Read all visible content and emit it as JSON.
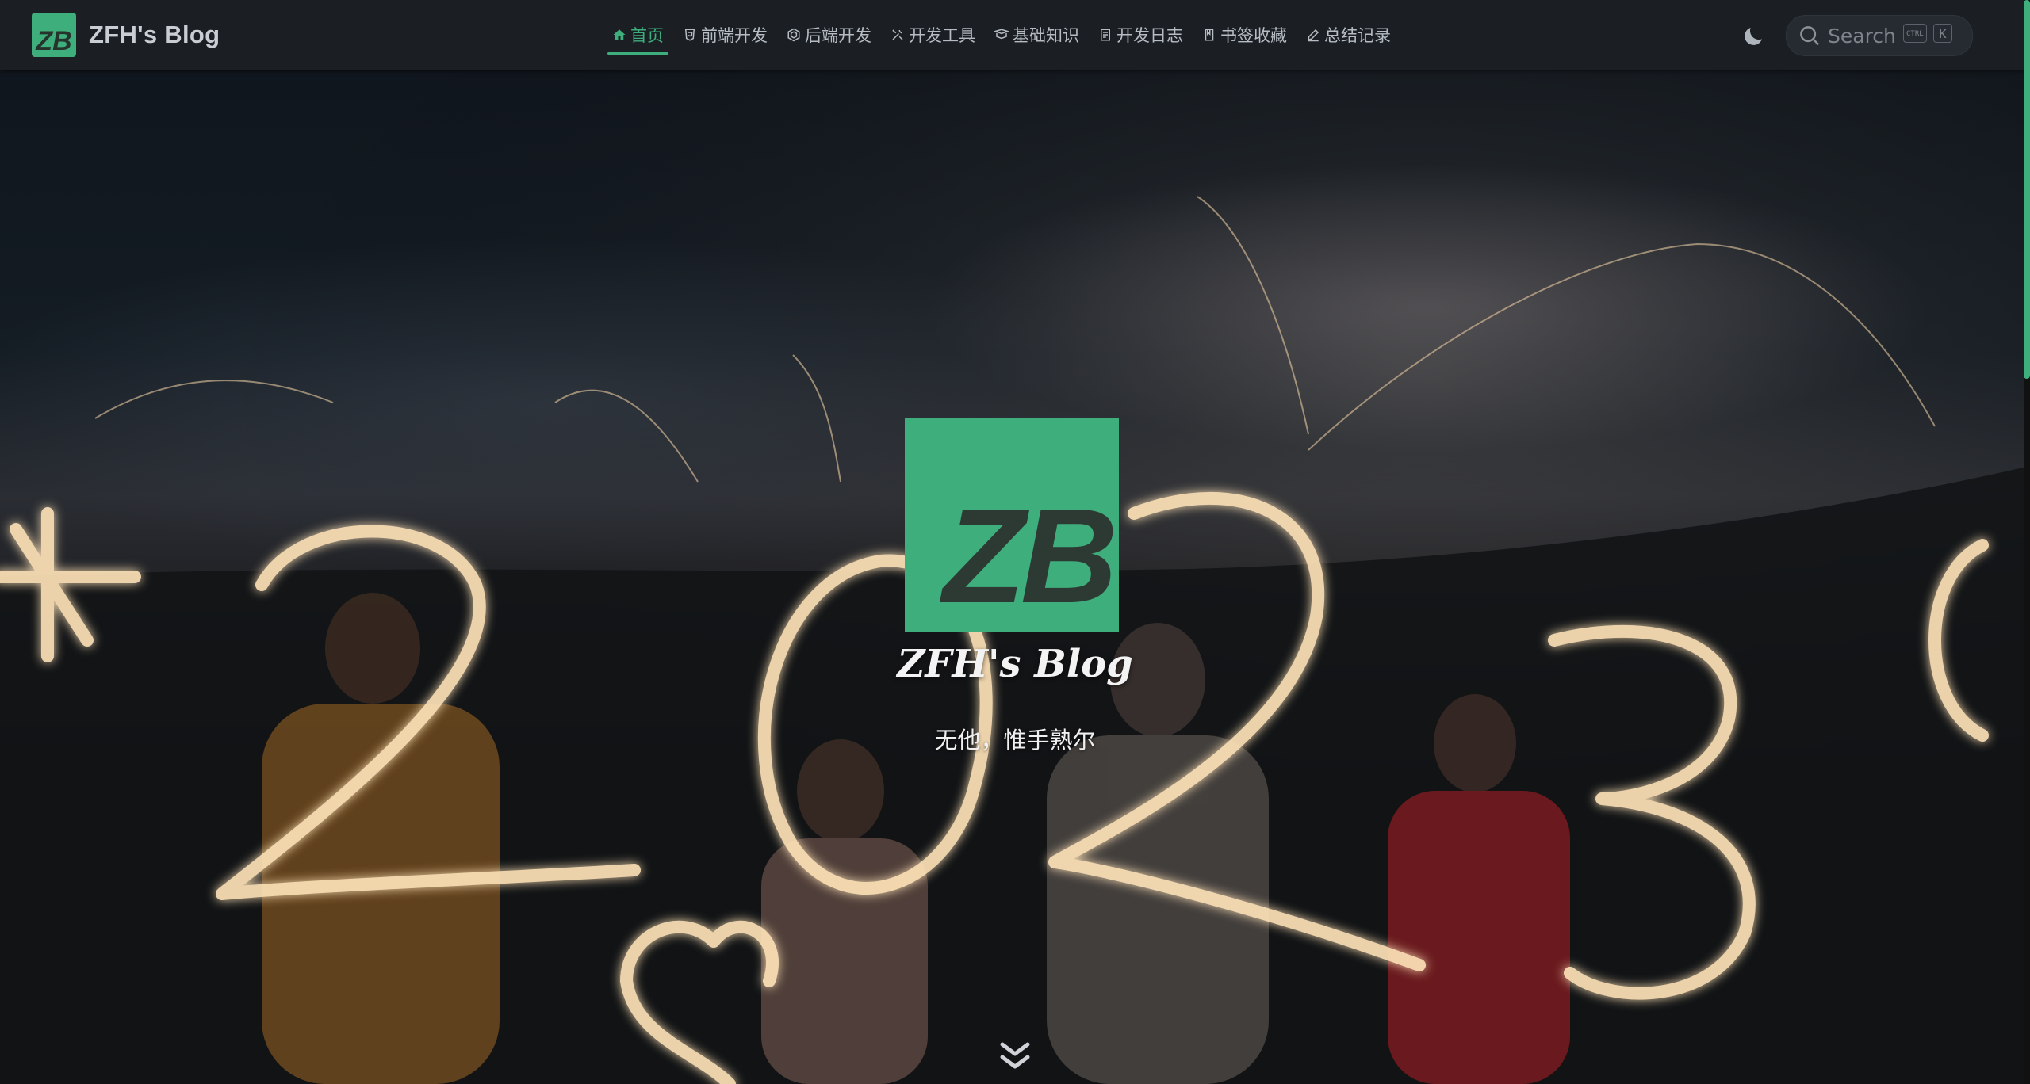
{
  "navbar": {
    "brand_logo_text": "ZB",
    "brand_title": "ZFH's Blog",
    "items": [
      {
        "label": "首页",
        "icon": "home-icon",
        "active": true
      },
      {
        "label": "前端开发",
        "icon": "html5-icon",
        "active": false
      },
      {
        "label": "后端开发",
        "icon": "hexagon-icon",
        "active": false
      },
      {
        "label": "开发工具",
        "icon": "tools-icon",
        "active": false
      },
      {
        "label": "基础知识",
        "icon": "book-icon",
        "active": false
      },
      {
        "label": "开发日志",
        "icon": "notes-icon",
        "active": false
      },
      {
        "label": "书签收藏",
        "icon": "bookmark-icon",
        "active": false
      },
      {
        "label": "总结记录",
        "icon": "pen-icon",
        "active": false
      }
    ],
    "theme_toggle_icon": "moon-icon",
    "search": {
      "placeholder": "Search",
      "kbd_ctrl": "CTRL",
      "kbd_k": "K"
    }
  },
  "hero": {
    "logo_text": "ZB",
    "title": "ZFH's Blog",
    "tagline": "无他，惟手熟尔",
    "scroll_icon": "chevron-double-down-icon",
    "background": "night sparkler photo spelling 2023"
  },
  "colors": {
    "accent": "#3eaf7c",
    "navbar_bg": "#1b1f24",
    "text": "#b6bcc4"
  }
}
